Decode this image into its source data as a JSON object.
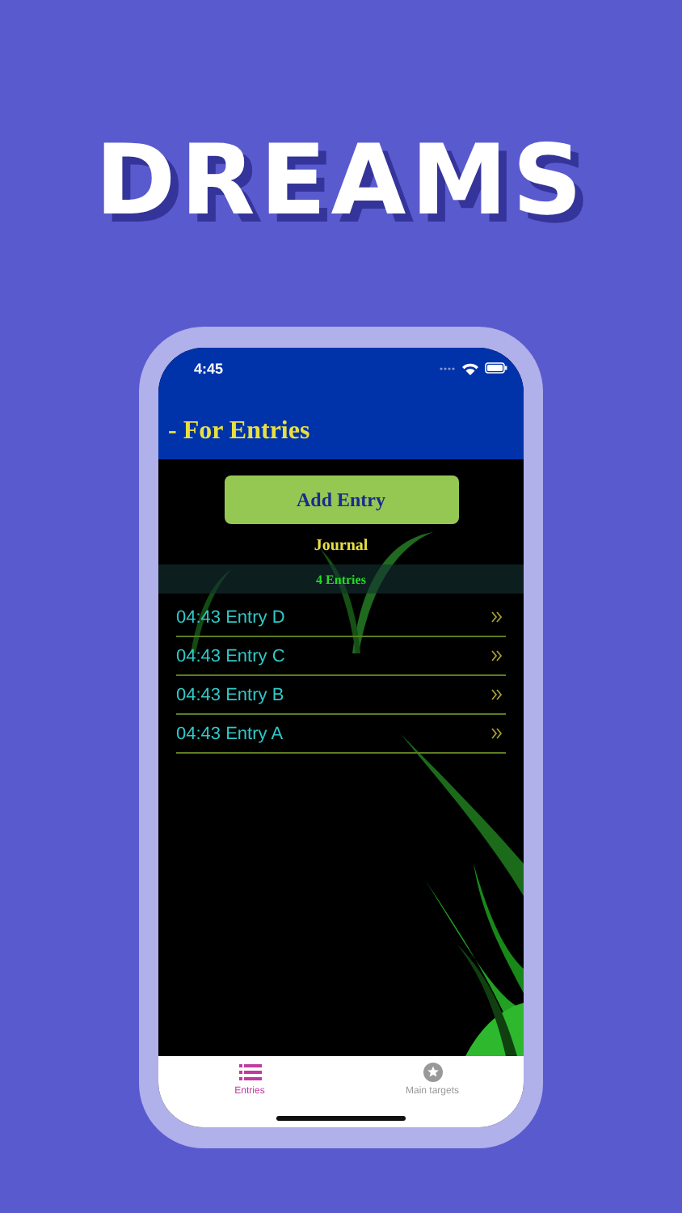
{
  "headline": "DREAMS",
  "status_bar": {
    "time": "4:45"
  },
  "nav_bar": {
    "title": "- For Entries"
  },
  "add_button": {
    "label": "Add Entry"
  },
  "section_title": "Journal",
  "count_label": "4 Entries",
  "entries": [
    {
      "label": "04:43 Entry D"
    },
    {
      "label": "04:43 Entry C"
    },
    {
      "label": "04:43 Entry B"
    },
    {
      "label": "04:43 Entry A"
    }
  ],
  "tab_bar": [
    {
      "label": "Entries",
      "kind": "list",
      "selected": true
    },
    {
      "label": "Main targets",
      "kind": "star",
      "selected": false
    }
  ]
}
